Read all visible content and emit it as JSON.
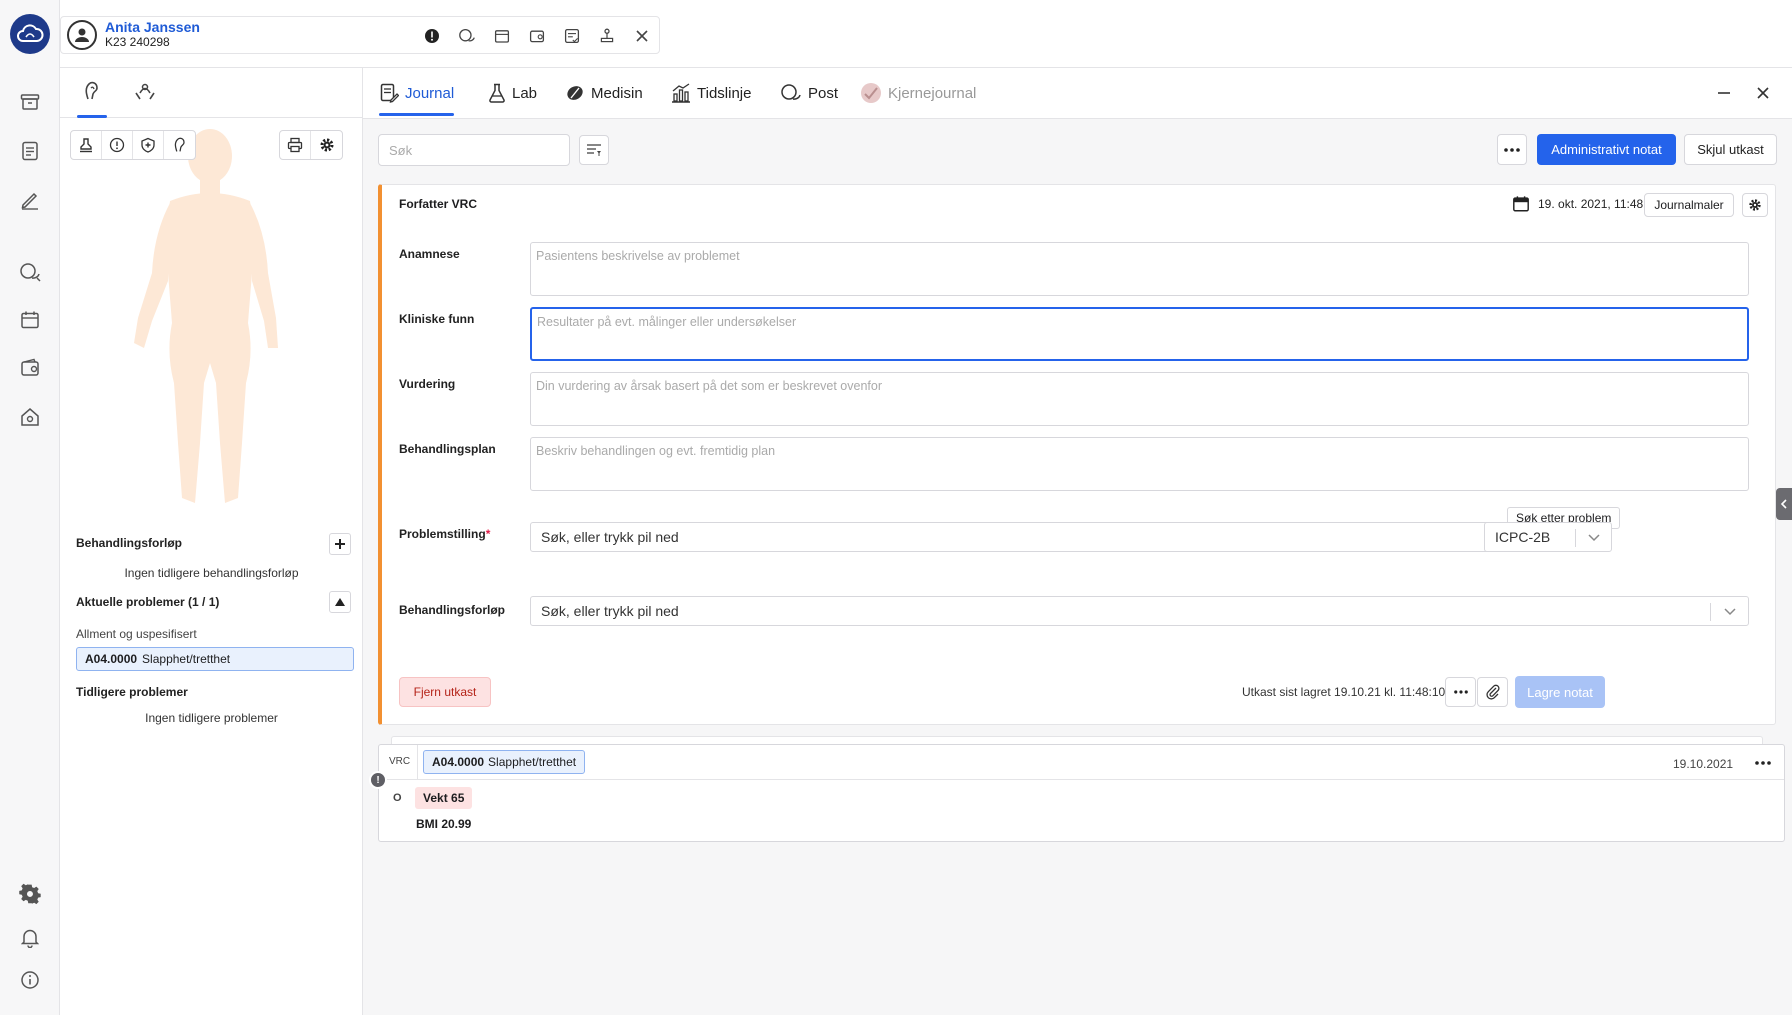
{
  "patient": {
    "name": "Anita Janssen",
    "id": "K23 240298"
  },
  "left_panel": {
    "treatment_title": "Behandlingsforløp",
    "treatment_empty": "Ingen tidligere behandlingsforløp",
    "current_problems_title": "Aktuelle problemer (1 / 1)",
    "category": "Allment og uspesifisert",
    "problem": {
      "code": "A04.0000",
      "text": "Slapphet/tretthet"
    },
    "previous_title": "Tidligere problemer",
    "previous_empty": "Ingen tidligere problemer"
  },
  "tabs": [
    {
      "label": "Journal",
      "icon": "journal-icon"
    },
    {
      "label": "Lab",
      "icon": "flask-icon"
    },
    {
      "label": "Medisin",
      "icon": "pill-icon"
    },
    {
      "label": "Tidslinje",
      "icon": "chart-icon"
    },
    {
      "label": "Post",
      "icon": "chat-icon"
    },
    {
      "label": "Kjernejournal",
      "icon": "kjernejournal-icon"
    }
  ],
  "toolbar": {
    "search_placeholder": "Søk",
    "admin_note": "Administrativt notat",
    "hide_draft": "Skjul utkast"
  },
  "note": {
    "author": "Forfatter VRC",
    "date": "19. okt. 2021, 11:48",
    "templates": "Journalmaler",
    "fields": [
      {
        "label": "Anamnese",
        "placeholder": "Pasientens beskrivelse av problemet"
      },
      {
        "label": "Kliniske funn",
        "placeholder": "Resultater på evt. målinger eller undersøkelser"
      },
      {
        "label": "Vurdering",
        "placeholder": "Din vurdering av årsak basert på det som er beskrevet ovenfor"
      },
      {
        "label": "Behandlingsplan",
        "placeholder": "Beskriv behandlingen og evt. fremtidig plan"
      }
    ],
    "problem_label": "Problemstilling",
    "required_mark": "*",
    "search_problem_tip": "Søk etter problem",
    "problem_select": "Søk, eller trykk pil ned",
    "code_system": "ICPC-2B",
    "treatment_label": "Behandlingsforløp",
    "treatment_select": "Søk, eller trykk pil ned",
    "remove_draft": "Fjern utkast",
    "saved_text": "Utkast sist lagret 19.10.21 kl. 11:48:10",
    "save": "Lagre notat"
  },
  "entry": {
    "author": "VRC",
    "problem": {
      "code": "A04.0000",
      "text": "Slapphet/tretthet"
    },
    "date": "19.10.2021",
    "alert": "!",
    "o_label": "O",
    "vekt": "Vekt 65",
    "bmi": "BMI 20.99"
  },
  "colors": {
    "accent": "#2463eb",
    "draft_border": "#f29031",
    "danger_bg": "#fde2e2"
  }
}
